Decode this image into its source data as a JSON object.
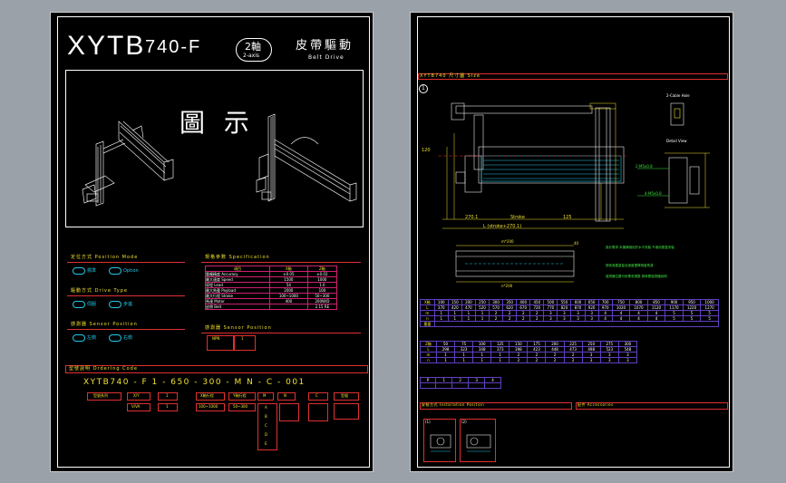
{
  "left": {
    "model": "XYTB",
    "series": "740-F",
    "axes_badge": "2軸",
    "axes_badge_en": "2-axis",
    "drive_cn": "皮帶驅動",
    "drive_en": "Belt Drive",
    "figure_label": "圖 示",
    "section_model": "定位方式 Position Mode",
    "section_motor": "驅動方式 Drive Type",
    "section_spec": "規格參數 Specification",
    "section_sensor": "感測器 Sensor Position",
    "section_order": "型號說明 Ordering Code",
    "opt_a1": "標準",
    "opt_a2": "Option",
    "opt_b1": "伺服",
    "opt_b2": "步進",
    "opt_c1": "左側",
    "opt_c2": "右側",
    "sensor_cell_1": "NPN",
    "sensor_cell_2": "1",
    "spec_rows": [
      [
        "項目",
        "X軸",
        "Z軸"
      ],
      [
        "重複精度 Accuracy",
        "±0.05",
        "±0.02"
      ],
      [
        "最大速度 Speed",
        "1500",
        "1000"
      ],
      [
        "導程 Lead",
        "54",
        "1.0"
      ],
      [
        "最大負載 Payload",
        "2000",
        "100"
      ],
      [
        "最大行程 Stroke",
        "100~1000",
        "50~300"
      ],
      [
        "馬達 Motor",
        "400",
        "200W/D"
      ],
      [
        "皮帶 Belt",
        "",
        "2.15 RE"
      ]
    ],
    "order_code": "XYTB740 - F   1  -  650  -  300  -  M    N  -  C  -  001",
    "order_boxes": [
      "型號系列",
      "X/Y",
      "1",
      "X軸行程",
      "Y軸行程",
      "M",
      "N",
      "C",
      "型號"
    ],
    "order_options": [
      "V/VA",
      "1",
      "100~1000",
      "50~300",
      "A",
      "B",
      "C",
      "D",
      "E"
    ]
  },
  "right": {
    "title_bar": "XYTB740 尺寸圖 Size",
    "circle_num": "1",
    "dim_bottom": "L (stroke+270.1)",
    "dim_stroke": "Stroke",
    "dim_a": "270.1",
    "dim_b": "125",
    "dim_c": "40",
    "dim_top": "m*200",
    "dim_bot2": "n*200",
    "dim_left_w": "120",
    "note1": "設計需求 本機構適用於水平安裝 不適用垂直安裝",
    "note2": "請依負載重量及速度選擇適當馬達",
    "note3": "感測器位置可依需求調整 請參閱感測器說明",
    "label_cable": "2-Cable Hole",
    "label_detail": "Detail View",
    "label_motor": "2-M5x0.8",
    "label_hole": "4-M5x0.8",
    "table1_header": [
      "X軸",
      "100",
      "150",
      "200",
      "250",
      "300",
      "350",
      "400",
      "450",
      "500",
      "550",
      "600",
      "650",
      "700",
      "750",
      "800",
      "850",
      "900",
      "950",
      "1000"
    ],
    "table1_rows": [
      [
        "L",
        "370",
        "420",
        "470",
        "520",
        "570",
        "620",
        "670",
        "720",
        "770",
        "820",
        "870",
        "920",
        "970",
        "1020",
        "1070",
        "1120",
        "1170",
        "1220",
        "1270"
      ],
      [
        "m",
        "1",
        "1",
        "1",
        "1",
        "2",
        "2",
        "2",
        "2",
        "3",
        "3",
        "3",
        "3",
        "4",
        "4",
        "4",
        "4",
        "5",
        "5",
        "5"
      ],
      [
        "n",
        "1",
        "1",
        "1",
        "1",
        "2",
        "2",
        "2",
        "2",
        "3",
        "3",
        "3",
        "3",
        "4",
        "4",
        "4",
        "4",
        "5",
        "5",
        "5"
      ]
    ],
    "table1_weight": "重量",
    "table2_header": [
      "Z軸",
      "50",
      "75",
      "100",
      "125",
      "150",
      "175",
      "200",
      "225",
      "250",
      "275",
      "300"
    ],
    "table2_rows": [
      [
        "L",
        "298",
        "323",
        "348",
        "373",
        "398",
        "423",
        "448",
        "473",
        "498",
        "523",
        "548"
      ],
      [
        "m",
        "1",
        "1",
        "1",
        "1",
        "2",
        "2",
        "2",
        "2",
        "3",
        "3",
        "3"
      ],
      [
        "n",
        "1",
        "1",
        "1",
        "1",
        "2",
        "2",
        "2",
        "2",
        "3",
        "3",
        "3"
      ]
    ],
    "small_table": [
      "P",
      "1",
      "2",
      "3",
      "4"
    ],
    "section_bracket": "安裝方式 Installation Position",
    "section_acc": "配件 Accessories",
    "mini1": "(1)",
    "mini2": "(2)"
  }
}
